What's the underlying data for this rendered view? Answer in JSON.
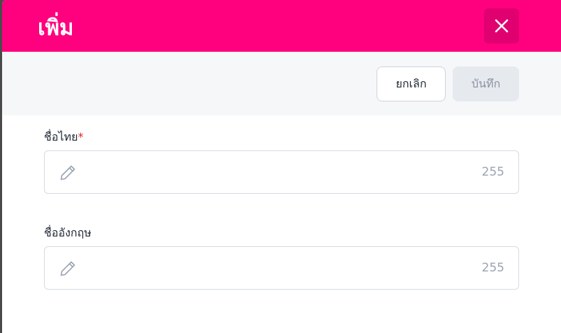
{
  "header": {
    "title": "เพิ่ม"
  },
  "toolbar": {
    "cancel_label": "ยกเลิก",
    "save_label": "บันทึก"
  },
  "fields": [
    {
      "label": "ชื่อไทย",
      "required_mark": "*",
      "value": "",
      "counter": "255"
    },
    {
      "label": "ชื่ออังกฤษ",
      "value": "",
      "counter": "255"
    }
  ],
  "colors": {
    "header_bg": "#ff007f",
    "close_bg": "#e0006f",
    "required": "#e02424"
  },
  "icons": {
    "close": "close-icon",
    "edit": "pencil-icon"
  }
}
